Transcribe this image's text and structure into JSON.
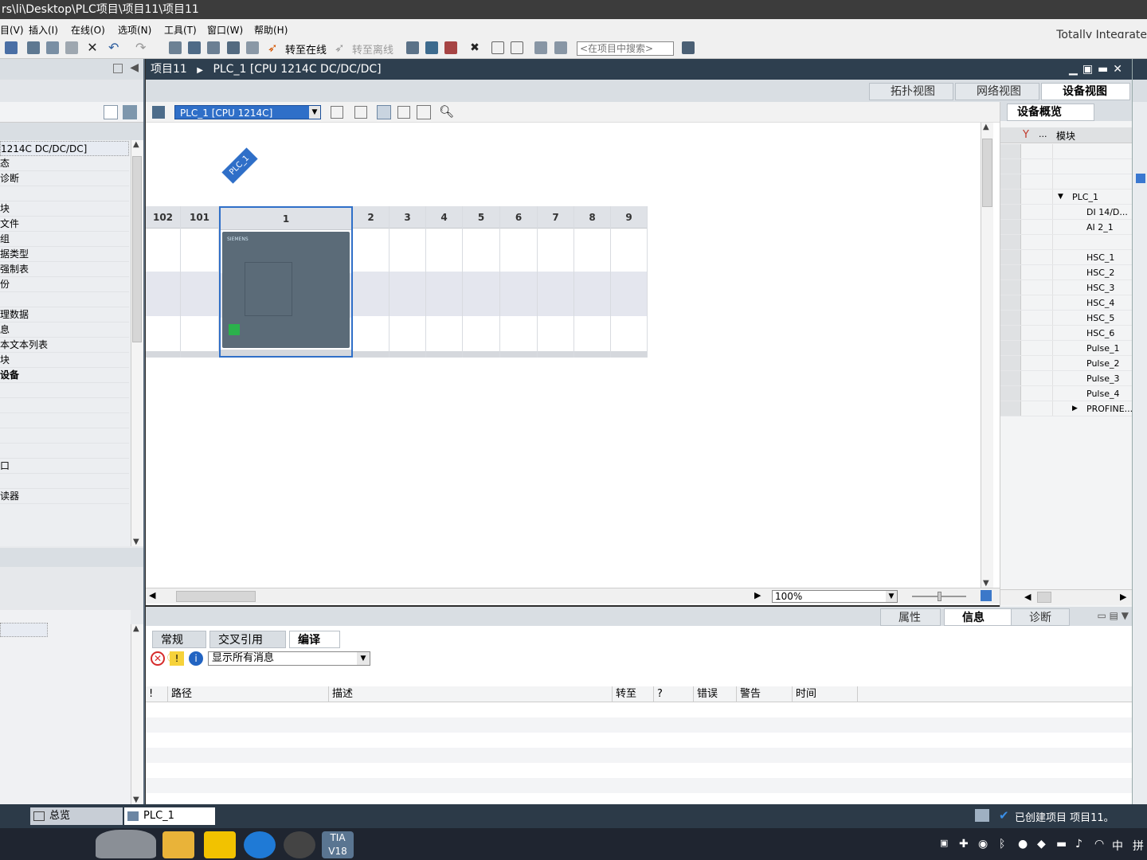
{
  "window": {
    "title": "rs\\li\\Desktop\\PLC项目\\项目11\\项目11",
    "brand": "Totally Integrate"
  },
  "menu": {
    "items": [
      "目(V)",
      "插入(I)",
      "在线(O)",
      "选项(N)",
      "工具(T)",
      "窗口(W)",
      "帮助(H)"
    ]
  },
  "toolbar": {
    "go_online": "转至在线",
    "go_offline": "转至离线",
    "search_placeholder": "<在项目中搜索>"
  },
  "project_tree": {
    "items": [
      "1214C DC/DC/DC]",
      "态",
      "诊断",
      "",
      "块",
      "文件",
      "组",
      "据类型",
      "强制表",
      "份",
      "",
      "理数据",
      "息",
      "本文本列表",
      "块",
      "设备",
      "",
      "",
      "",
      "",
      "",
      "口",
      "",
      "读器"
    ]
  },
  "editor": {
    "breadcrumb_project": "项目11",
    "breadcrumb_device": "PLC_1 [CPU 1214C DC/DC/DC]",
    "view_tabs": [
      "拓扑视图",
      "网络视图",
      "设备视图"
    ],
    "device_select": "PLC_1 [CPU 1214C]",
    "plc_tag": "PLC_1",
    "slots": [
      "102",
      "101",
      "1",
      "2",
      "3",
      "4",
      "5",
      "6",
      "7",
      "8",
      "9"
    ],
    "zoom": "100%",
    "cpu_brand": "SIEMENS"
  },
  "device_overview": {
    "title": "设备概览",
    "col_module": "模块",
    "col_dots": "...",
    "rows": [
      {
        "label": "",
        "indent": 0
      },
      {
        "label": "",
        "indent": 0
      },
      {
        "label": "",
        "indent": 0
      },
      {
        "label": "PLC_1",
        "indent": 1,
        "expand": "▼"
      },
      {
        "label": "DI 14/D...",
        "indent": 2
      },
      {
        "label": "AI 2_1",
        "indent": 2
      },
      {
        "label": "",
        "indent": 2
      },
      {
        "label": "HSC_1",
        "indent": 2
      },
      {
        "label": "HSC_2",
        "indent": 2
      },
      {
        "label": "HSC_3",
        "indent": 2
      },
      {
        "label": "HSC_4",
        "indent": 2
      },
      {
        "label": "HSC_5",
        "indent": 2
      },
      {
        "label": "HSC_6",
        "indent": 2
      },
      {
        "label": "Pulse_1",
        "indent": 2
      },
      {
        "label": "Pulse_2",
        "indent": 2
      },
      {
        "label": "Pulse_3",
        "indent": 2
      },
      {
        "label": "Pulse_4",
        "indent": 2
      },
      {
        "label": "PROFINE...",
        "indent": 2,
        "expand": "▶"
      }
    ]
  },
  "inspector": {
    "tabs": [
      "属性",
      "信息",
      "诊断"
    ],
    "subtabs": [
      "常规",
      "交叉引用",
      "编译"
    ],
    "filter_value": "显示所有消息",
    "columns": [
      "!",
      "路径",
      "描述",
      "转至",
      "?",
      "错误",
      "警告",
      "时间"
    ]
  },
  "statusbar": {
    "tab_overview": "总览",
    "tab_plc": "PLC_1",
    "message": "已创建项目 项目11。"
  },
  "taskbar": {
    "tray_text": [
      "中",
      "拼"
    ]
  }
}
